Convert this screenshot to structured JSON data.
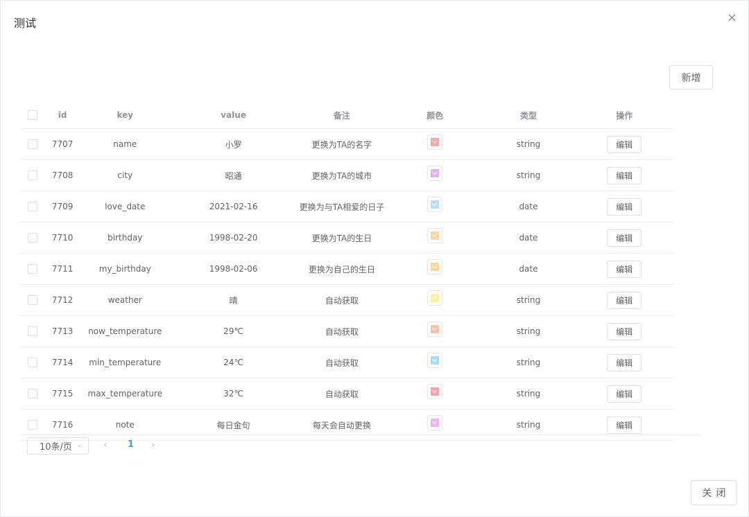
{
  "dialog": {
    "title": "测试",
    "close_glyph": "×"
  },
  "toolbar": {
    "add_label": "新增"
  },
  "table": {
    "headers": {
      "id": "id",
      "key": "key",
      "value": "value",
      "note": "备注",
      "color": "颜色",
      "type": "类型",
      "action": "操作"
    },
    "edit_label": "编辑",
    "rows": [
      {
        "id": "7707",
        "key": "name",
        "value": "小罗",
        "note": "更换为TA的名字",
        "color": "#f7a9a9",
        "type": "string"
      },
      {
        "id": "7708",
        "key": "city",
        "value": "昭通",
        "note": "更换为TA的城市",
        "color": "#e0b3f0",
        "type": "string"
      },
      {
        "id": "7709",
        "key": "love_date",
        "value": "2021-02-16",
        "note": "更换为与TA相爱的日子",
        "color": "#bfdcf7",
        "type": "date"
      },
      {
        "id": "7710",
        "key": "birthday",
        "value": "1998-02-20",
        "note": "更换为TA的生日",
        "color": "#fbd79c",
        "type": "date"
      },
      {
        "id": "7711",
        "key": "my_birthday",
        "value": "1998-02-06",
        "note": "更换为自己的生日",
        "color": "#fbd89a",
        "type": "date"
      },
      {
        "id": "7712",
        "key": "weather",
        "value": "晴",
        "note": "自动获取",
        "color": "#fdf0a0",
        "type": "string"
      },
      {
        "id": "7713",
        "key": "now_temperature",
        "value": "29℃",
        "note": "自动获取",
        "color": "#fbc2a6",
        "type": "string"
      },
      {
        "id": "7714",
        "key": "min_temperature",
        "value": "24℃",
        "note": "自动获取",
        "color": "#a9dcf7",
        "type": "string"
      },
      {
        "id": "7715",
        "key": "max_temperature",
        "value": "32℃",
        "note": "自动获取",
        "color": "#f7a3a8",
        "type": "string"
      },
      {
        "id": "7716",
        "key": "note",
        "value": "每日金句",
        "note": "每天会自动更换",
        "color": "#f0b3f7",
        "type": "string"
      }
    ]
  },
  "pagination": {
    "page_size_label": "10条/页",
    "current_page": "1",
    "prev_glyph": "‹",
    "next_glyph": "›",
    "caret_glyph": "⌄"
  },
  "footer": {
    "close_label": "关闭"
  }
}
